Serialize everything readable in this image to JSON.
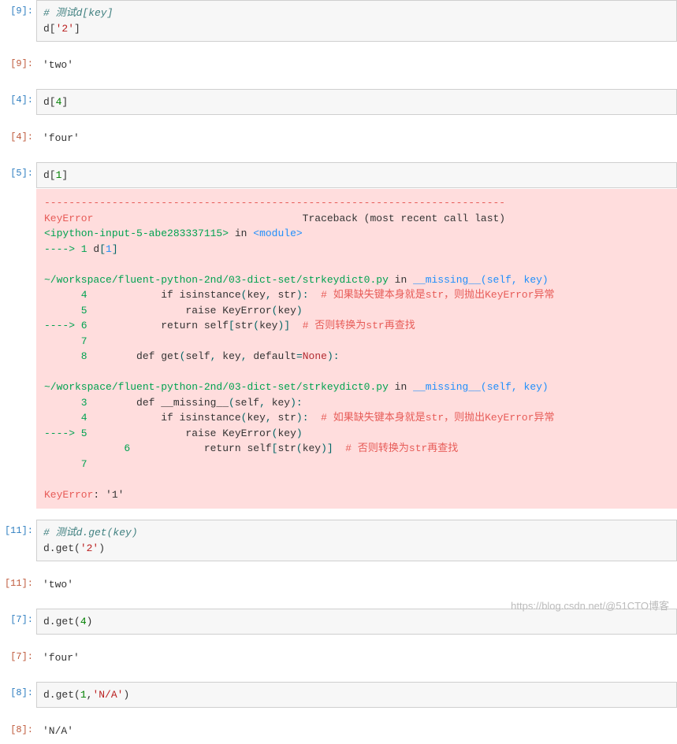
{
  "cells": {
    "c0_prompt": "[9]:",
    "c0_comment": "# 测试d[key]",
    "c0_line1_a": "d[",
    "c0_line1_b": "'2'",
    "c0_line1_c": "]",
    "c0_out_prompt": "[9]:",
    "c0_out": "'two'",
    "c1_prompt": "[4]:",
    "c1_line_a": "d[",
    "c1_line_b": "4",
    "c1_line_c": "]",
    "c1_out_prompt": "[4]:",
    "c1_out": "'four'",
    "c2_prompt": "[5]:",
    "c2_line_a": "d[",
    "c2_line_b": "1",
    "c2_line_c": "]",
    "err_dash": "---------------------------------------------------------------------------",
    "err_keyerror": "KeyError",
    "err_traceback": "                                  Traceback (most recent call last)",
    "err_ipy_a": "<ipython-input-5-abe283337115>",
    "err_ipy_b": " in ",
    "err_ipy_c": "<module>",
    "err_arrow1": "----> 1",
    "err_arrow1_b": " d",
    "err_arrow1_c": "[",
    "err_arrow1_d": "1",
    "err_arrow1_e": "]",
    "err_path1_a": "~/workspace/fluent-python-2nd/03-dict-set/strkeydict0.py",
    "err_path1_b": " in ",
    "err_path1_c": "__missing__",
    "err_path1_d": "(self, key)",
    "err_l4": "      4",
    "err_l4t_a": "            if isinstance",
    "err_l4t_b": "(",
    "err_l4t_c": "key",
    "err_l4t_d": ",",
    "err_l4t_e": " str",
    "err_l4t_f": "):",
    "err_l4t_g": "  # 如果缺失键本身就是str，则抛出KeyError异常",
    "err_l5": "      5",
    "err_l5t": "                raise KeyError",
    "err_l5t_b": "(",
    "err_l5t_c": "key",
    "err_l5t_d": ")",
    "err_l6a": "----> 6",
    "err_l6t_a": "            return self",
    "err_l6t_b": "[",
    "err_l6t_c": "str",
    "err_l6t_d": "(",
    "err_l6t_e": "key",
    "err_l6t_f": ")]",
    "err_l6t_g": "  # 否则转换为str再查找",
    "err_l7": "      7 ",
    "err_l8": "      8",
    "err_l8t_a": "        def get",
    "err_l8t_b": "(",
    "err_l8t_c": "self",
    "err_l8t_d": ",",
    "err_l8t_e": " key",
    "err_l8t_f": ",",
    "err_l8t_g": " default",
    "err_l8t_h": "=",
    "err_l8t_i": "None",
    "err_l8t_j": "):",
    "err2_l3": "      3",
    "err2_l3t_a": "        def __missing__",
    "err2_l3t_b": "(",
    "err2_l3t_c": "self",
    "err2_l3t_d": ",",
    "err2_l3t_e": " key",
    "err2_l3t_f": "):",
    "err2_l5a": "----> 5",
    "err_final_a": "KeyError",
    "err_final_b": ": '1'",
    "c3_prompt": "[11]:",
    "c3_comment": "# 测试d.get(key)",
    "c3_line_a": "d.get(",
    "c3_line_b": "'2'",
    "c3_line_c": ")",
    "c3_out_prompt": "[11]:",
    "c3_out": "'two'",
    "c4_prompt": "[7]:",
    "c4_line_a": "d.get(",
    "c4_line_b": "4",
    "c4_line_c": ")",
    "c4_out_prompt": "[7]:",
    "c4_out": "'four'",
    "c5_prompt": "[8]:",
    "c5_line_a": "d.get(",
    "c5_line_b": "1",
    "c5_line_c": ",",
    "c5_line_d": "'N/A'",
    "c5_line_e": ")",
    "c5_out_prompt": "[8]:",
    "c5_out": "'N/A'"
  },
  "watermark": "https://blog.csdn.net/@51CTO博客"
}
